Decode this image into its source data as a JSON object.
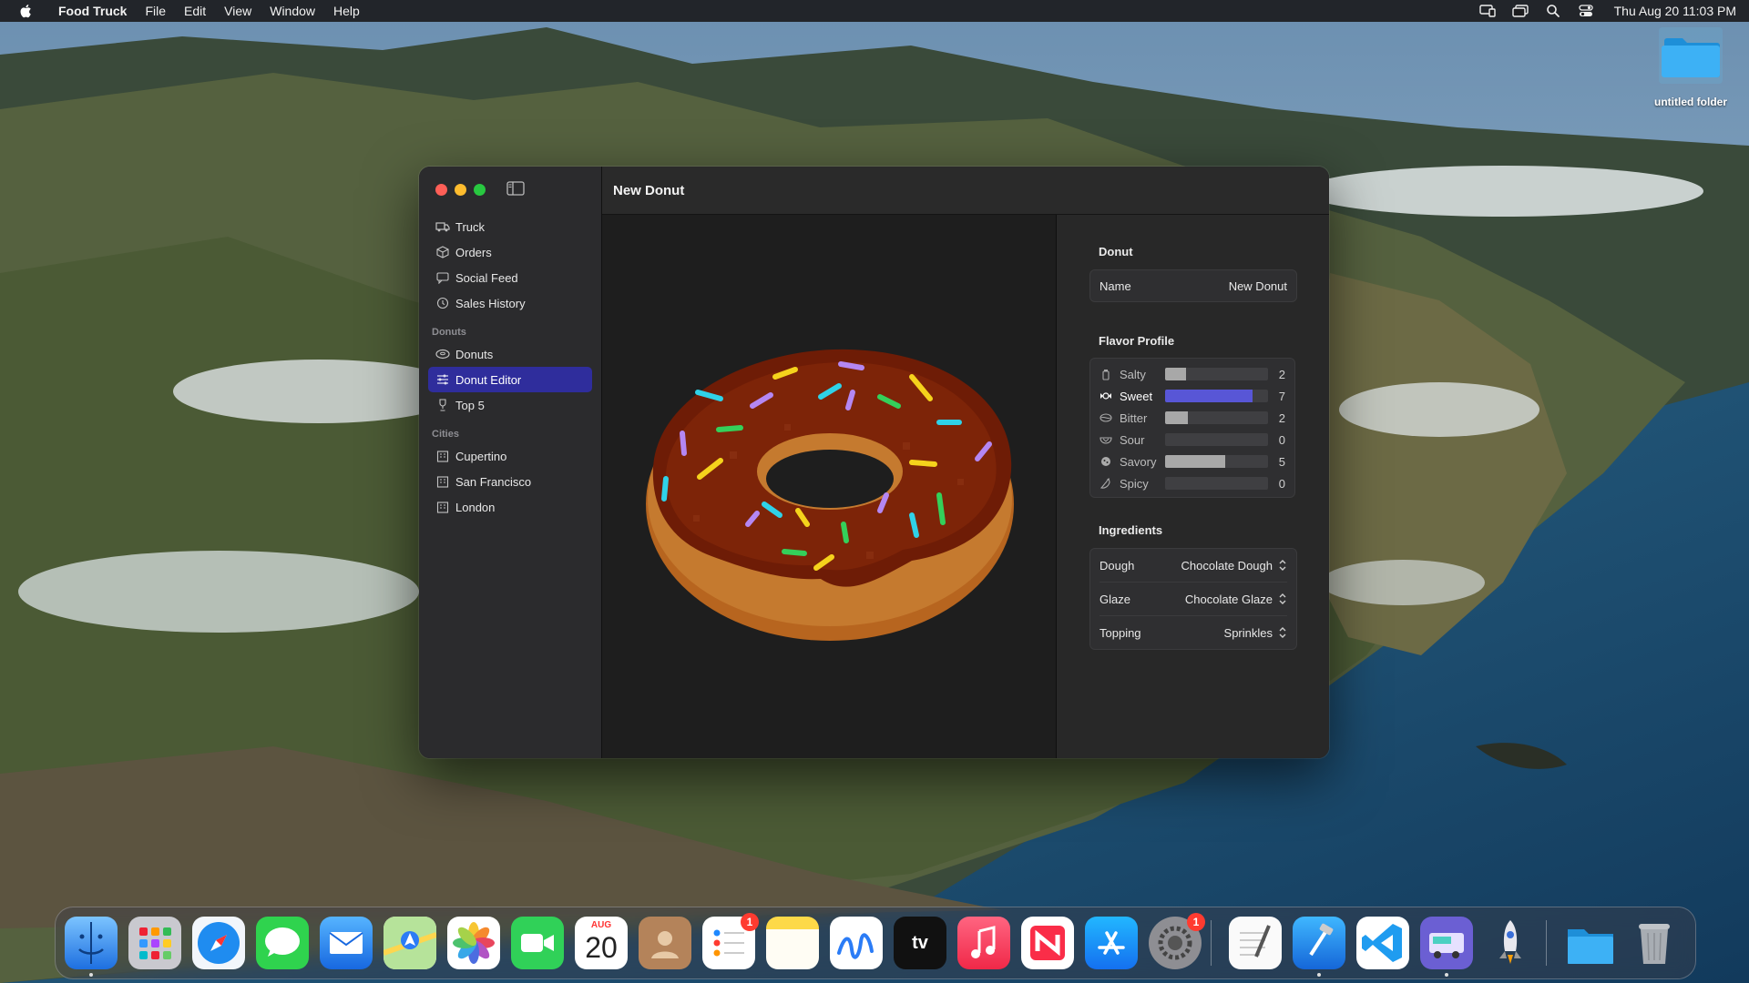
{
  "menubar": {
    "app_name": "Food Truck",
    "items": [
      "File",
      "Edit",
      "View",
      "Window",
      "Help"
    ],
    "clock": "Thu Aug 20  11:03 PM"
  },
  "desktop": {
    "folder_label": "untitled folder"
  },
  "window": {
    "title": "New Donut",
    "sidebar": {
      "main_items": [
        {
          "label": "Truck",
          "icon": "truck-icon"
        },
        {
          "label": "Orders",
          "icon": "box-icon"
        },
        {
          "label": "Social Feed",
          "icon": "message-icon"
        },
        {
          "label": "Sales History",
          "icon": "clock-icon"
        }
      ],
      "donuts_header": "Donuts",
      "donut_items": [
        {
          "label": "Donuts",
          "icon": "donut-icon"
        },
        {
          "label": "Donut Editor",
          "icon": "sliders-icon",
          "selected": true
        },
        {
          "label": "Top 5",
          "icon": "trophy-icon"
        }
      ],
      "cities_header": "Cities",
      "city_items": [
        {
          "label": "Cupertino",
          "icon": "building-icon"
        },
        {
          "label": "San Francisco",
          "icon": "building-icon"
        },
        {
          "label": "London",
          "icon": "building-icon"
        }
      ]
    },
    "inspector": {
      "donut_title": "Donut",
      "name_label": "Name",
      "name_value": "New Donut",
      "flavor_title": "Flavor Profile",
      "flavors": [
        {
          "name": "Salty",
          "value": "2",
          "level": 0.2
        },
        {
          "name": "Sweet",
          "value": "7",
          "level": 0.85,
          "active": true
        },
        {
          "name": "Bitter",
          "value": "2",
          "level": 0.22
        },
        {
          "name": "Sour",
          "value": "0",
          "level": 0
        },
        {
          "name": "Savory",
          "value": "5",
          "level": 0.58
        },
        {
          "name": "Spicy",
          "value": "0",
          "level": 0
        }
      ],
      "ingredients_title": "Ingredients",
      "ingredients": [
        {
          "label": "Dough",
          "value": "Chocolate Dough"
        },
        {
          "label": "Glaze",
          "value": "Chocolate Glaze"
        },
        {
          "label": "Topping",
          "value": "Sprinkles"
        }
      ]
    }
  },
  "dock": {
    "calendar_month": "AUG",
    "calendar_day": "20",
    "tv_label": "tv",
    "badges": {
      "reminders": "1",
      "settings": "1"
    },
    "colors": {
      "accent": "#5856d6",
      "selection": "#2f2d9c"
    }
  }
}
